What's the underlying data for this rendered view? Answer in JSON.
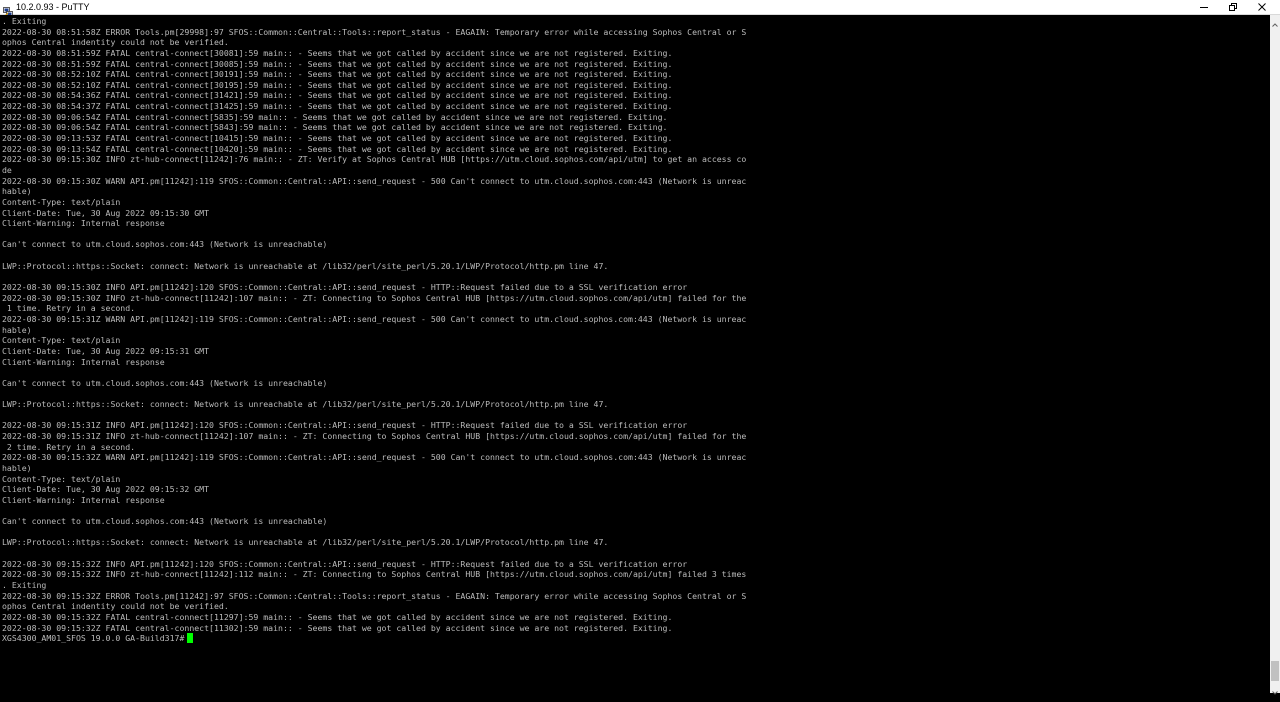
{
  "window": {
    "title": "10.2.0.93 - PuTTY",
    "icon": "putty-icon"
  },
  "controls": {
    "minimize_icon": "minimize-icon",
    "maximize_icon": "restore-icon",
    "close_icon": "close-icon"
  },
  "terminal": {
    "text_color": "#bbbbbb",
    "background": "#000000",
    "cursor_color": "#00ff00",
    "lines": [
      ". Exiting",
      "2022-08-30 08:51:58Z ERROR Tools.pm[29998]:97 SFOS::Common::Central::Tools::report_status - EAGAIN: Temporary error while accessing Sophos Central or S",
      "ophos Central indentity could not be verified.",
      "2022-08-30 08:51:59Z FATAL central-connect[30081]:59 main:: - Seems that we got called by accident since we are not registered. Exiting.",
      "2022-08-30 08:51:59Z FATAL central-connect[30085]:59 main:: - Seems that we got called by accident since we are not registered. Exiting.",
      "2022-08-30 08:52:10Z FATAL central-connect[30191]:59 main:: - Seems that we got called by accident since we are not registered. Exiting.",
      "2022-08-30 08:52:10Z FATAL central-connect[30195]:59 main:: - Seems that we got called by accident since we are not registered. Exiting.",
      "2022-08-30 08:54:36Z FATAL central-connect[31421]:59 main:: - Seems that we got called by accident since we are not registered. Exiting.",
      "2022-08-30 08:54:37Z FATAL central-connect[31425]:59 main:: - Seems that we got called by accident since we are not registered. Exiting.",
      "2022-08-30 09:06:54Z FATAL central-connect[5835]:59 main:: - Seems that we got called by accident since we are not registered. Exiting.",
      "2022-08-30 09:06:54Z FATAL central-connect[5843]:59 main:: - Seems that we got called by accident since we are not registered. Exiting.",
      "2022-08-30 09:13:53Z FATAL central-connect[10415]:59 main:: - Seems that we got called by accident since we are not registered. Exiting.",
      "2022-08-30 09:13:54Z FATAL central-connect[10420]:59 main:: - Seems that we got called by accident since we are not registered. Exiting.",
      "2022-08-30 09:15:30Z INFO zt-hub-connect[11242]:76 main:: - ZT: Verify at Sophos Central HUB [https://utm.cloud.sophos.com/api/utm] to get an access co",
      "de",
      "2022-08-30 09:15:30Z WARN API.pm[11242]:119 SFOS::Common::Central::API::send_request - 500 Can't connect to utm.cloud.sophos.com:443 (Network is unreac",
      "hable)",
      "Content-Type: text/plain",
      "Client-Date: Tue, 30 Aug 2022 09:15:30 GMT",
      "Client-Warning: Internal response",
      "",
      "Can't connect to utm.cloud.sophos.com:443 (Network is unreachable)",
      "",
      "LWP::Protocol::https::Socket: connect: Network is unreachable at /lib32/perl/site_perl/5.20.1/LWP/Protocol/http.pm line 47.",
      "",
      "2022-08-30 09:15:30Z INFO API.pm[11242]:120 SFOS::Common::Central::API::send_request - HTTP::Request failed due to a SSL verification error",
      "2022-08-30 09:15:30Z INFO zt-hub-connect[11242]:107 main:: - ZT: Connecting to Sophos Central HUB [https://utm.cloud.sophos.com/api/utm] failed for the",
      " 1 time. Retry in a second.",
      "2022-08-30 09:15:31Z WARN API.pm[11242]:119 SFOS::Common::Central::API::send_request - 500 Can't connect to utm.cloud.sophos.com:443 (Network is unreac",
      "hable)",
      "Content-Type: text/plain",
      "Client-Date: Tue, 30 Aug 2022 09:15:31 GMT",
      "Client-Warning: Internal response",
      "",
      "Can't connect to utm.cloud.sophos.com:443 (Network is unreachable)",
      "",
      "LWP::Protocol::https::Socket: connect: Network is unreachable at /lib32/perl/site_perl/5.20.1/LWP/Protocol/http.pm line 47.",
      "",
      "2022-08-30 09:15:31Z INFO API.pm[11242]:120 SFOS::Common::Central::API::send_request - HTTP::Request failed due to a SSL verification error",
      "2022-08-30 09:15:31Z INFO zt-hub-connect[11242]:107 main:: - ZT: Connecting to Sophos Central HUB [https://utm.cloud.sophos.com/api/utm] failed for the",
      " 2 time. Retry in a second.",
      "2022-08-30 09:15:32Z WARN API.pm[11242]:119 SFOS::Common::Central::API::send_request - 500 Can't connect to utm.cloud.sophos.com:443 (Network is unreac",
      "hable)",
      "Content-Type: text/plain",
      "Client-Date: Tue, 30 Aug 2022 09:15:32 GMT",
      "Client-Warning: Internal response",
      "",
      "Can't connect to utm.cloud.sophos.com:443 (Network is unreachable)",
      "",
      "LWP::Protocol::https::Socket: connect: Network is unreachable at /lib32/perl/site_perl/5.20.1/LWP/Protocol/http.pm line 47.",
      "",
      "2022-08-30 09:15:32Z INFO API.pm[11242]:120 SFOS::Common::Central::API::send_request - HTTP::Request failed due to a SSL verification error",
      "2022-08-30 09:15:32Z INFO zt-hub-connect[11242]:112 main:: - ZT: Connecting to Sophos Central HUB [https://utm.cloud.sophos.com/api/utm] failed 3 times",
      ". Exiting",
      "2022-08-30 09:15:32Z ERROR Tools.pm[11242]:97 SFOS::Common::Central::Tools::report_status - EAGAIN: Temporary error while accessing Sophos Central or S",
      "ophos Central indentity could not be verified.",
      "2022-08-30 09:15:32Z FATAL central-connect[11297]:59 main:: - Seems that we got called by accident since we are not registered. Exiting.",
      "2022-08-30 09:15:32Z FATAL central-connect[11302]:59 main:: - Seems that we got called by accident since we are not registered. Exiting."
    ],
    "prompt": "XGS4300_AM01_SFOS 19.0.0 GA-Build317#"
  }
}
